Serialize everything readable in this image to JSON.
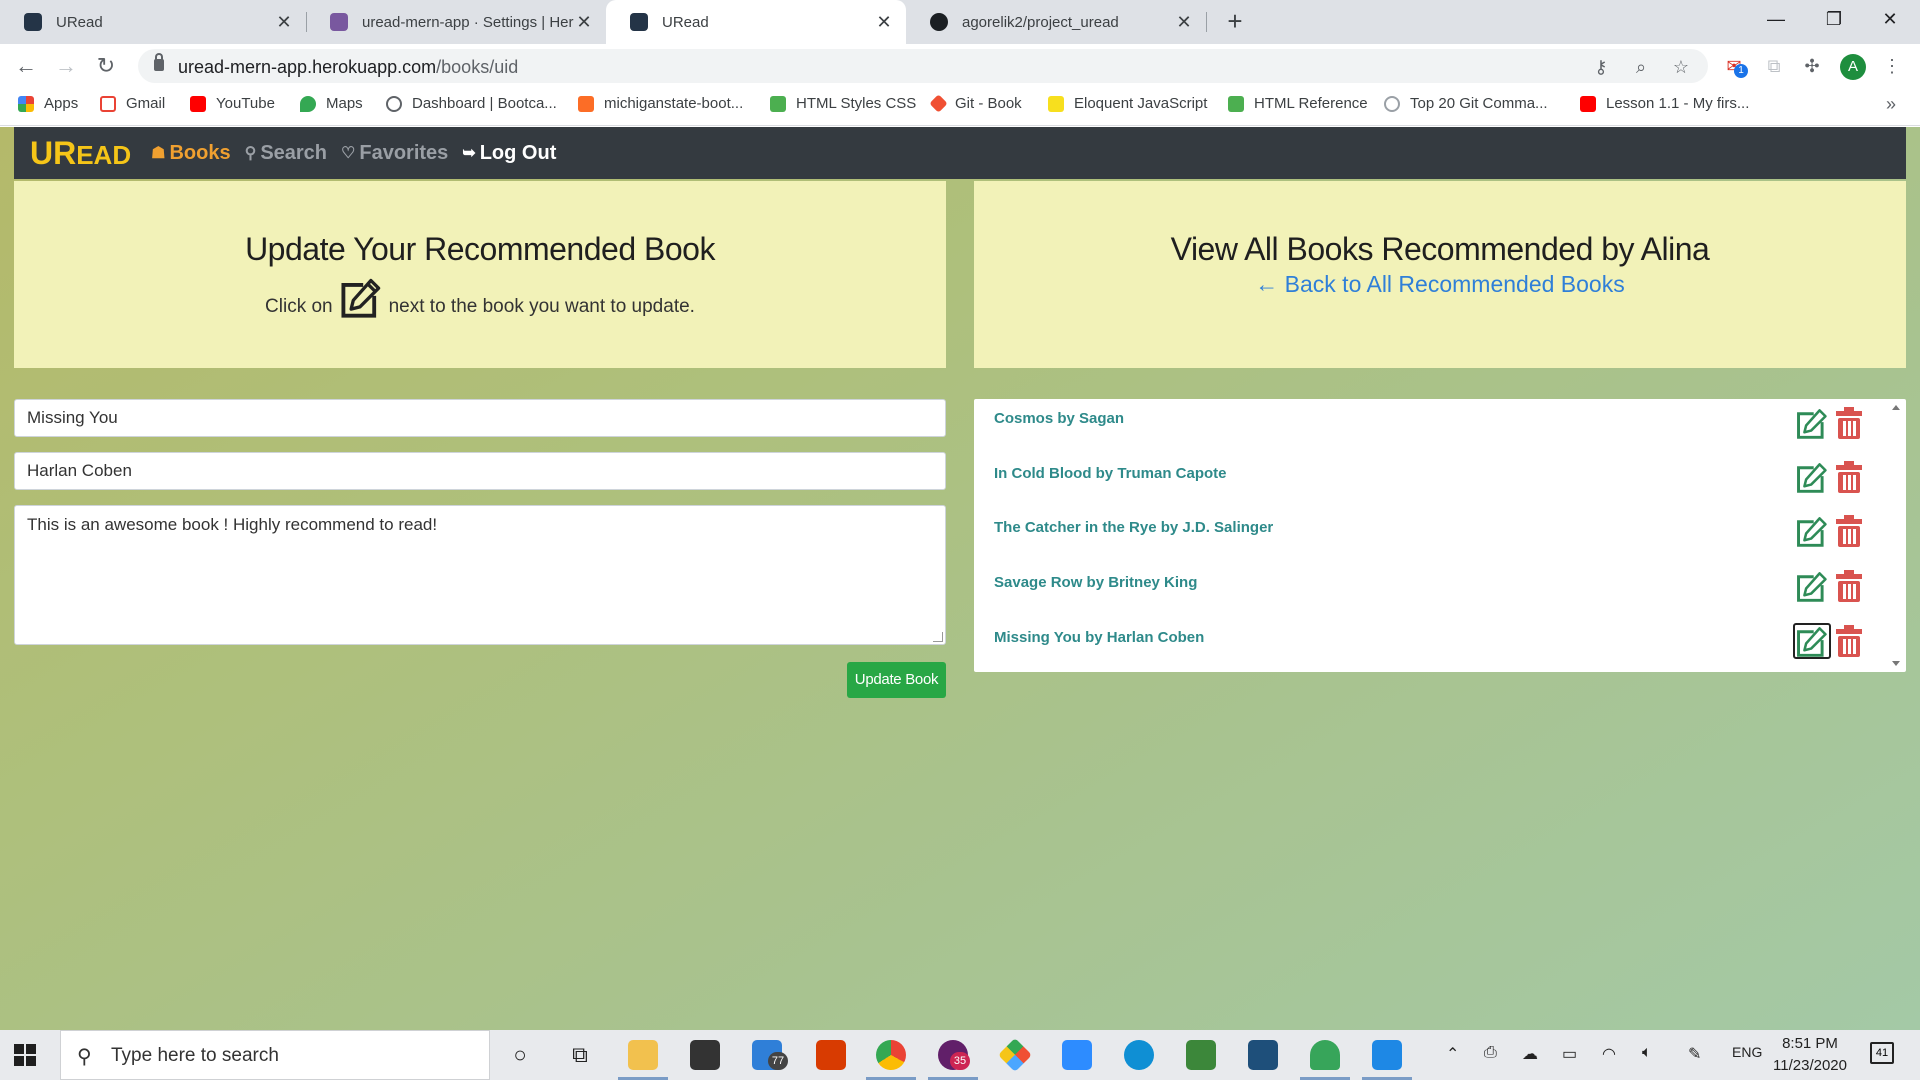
{
  "browser": {
    "tabs": [
      {
        "label": "URead",
        "active": false
      },
      {
        "label": "uread-mern-app · Settings | Herc",
        "active": false
      },
      {
        "label": "URead",
        "active": true
      },
      {
        "label": "agorelik2/project_uread",
        "active": false
      }
    ],
    "url_host": "uread-mern-app.herokuapp.com",
    "url_path": "/books/uid",
    "avatar_letter": "A",
    "extension_badge": "1",
    "bookmarks": [
      "Apps",
      "Gmail",
      "YouTube",
      "Maps",
      "Dashboard | Bootca...",
      "michiganstate-boot...",
      "HTML Styles CSS",
      "Git - Book",
      "Eloquent JavaScript",
      "HTML Reference",
      "Top 20 Git Comma...",
      "Lesson 1.1 - My firs..."
    ],
    "bookmarks_overflow": "»"
  },
  "app": {
    "brand": {
      "u": "U",
      "r": "R",
      "ead": "EAD"
    },
    "nav": {
      "books": "Books",
      "search": "Search",
      "favorites": "Favorites",
      "logout": "Log Out"
    },
    "left_panel": {
      "title": "Update Your Recommended Book",
      "hint_before": "Click on",
      "hint_after": "next to the book you want to update."
    },
    "right_panel": {
      "title": "View All Books Recommended by Alina",
      "back_link": "← Back to All Recommended Books"
    },
    "form": {
      "title_value": "Missing You",
      "author_value": "Harlan Coben",
      "review_value": "This is an awesome book ! Highly recommend to read!",
      "submit_label": "Update Book"
    },
    "books": [
      "Cosmos by Sagan",
      "In Cold Blood by Truman Capote",
      "The Catcher in the Rye by J.D. Salinger",
      "Savage Row by Britney King",
      "Missing You by Harlan Coben"
    ],
    "colors": {
      "brand": "#f5c518",
      "navbar": "#343a40",
      "jumbotron": "#f2f2b8",
      "book_link": "#2e8a8a",
      "edit_icon": "#2e8b57",
      "delete_icon": "#d9534f",
      "submit_button": "#28a745"
    }
  },
  "taskbar": {
    "search_placeholder": "Type here to search",
    "mail_badge": "77",
    "slack_badge": "35",
    "language": "ENG",
    "time": "8:51 PM",
    "date": "11/23/2020",
    "notifications": "41"
  }
}
